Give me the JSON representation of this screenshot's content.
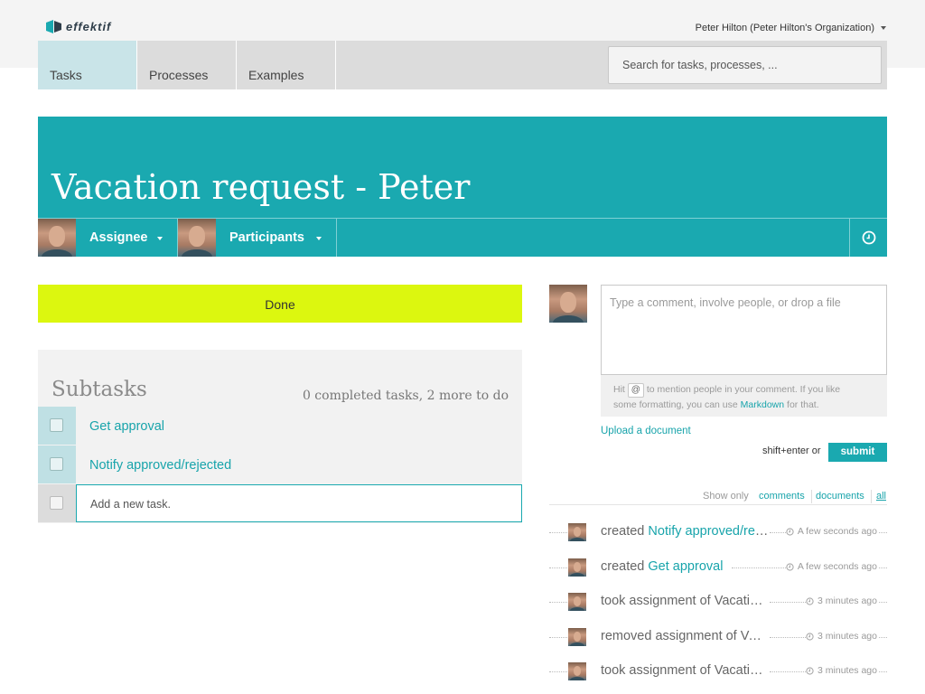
{
  "app": {
    "logo_text": "effektif"
  },
  "header": {
    "user_label": "Peter Hilton (Peter Hilton's Organization)"
  },
  "nav": {
    "tabs": [
      {
        "label": "Tasks",
        "active": true
      },
      {
        "label": "Processes",
        "active": false
      },
      {
        "label": "Examples",
        "active": false
      }
    ],
    "search_text": "Search for tasks, processes, ..."
  },
  "task": {
    "title": "Vacation request - Peter",
    "assignee_label": "Assignee",
    "participants_label": "Participants",
    "done_label": "Done"
  },
  "subtasks": {
    "title": "Subtasks",
    "summary": "0 completed tasks, 2 more to do",
    "items": [
      {
        "label": "Get approval",
        "checked": false
      },
      {
        "label": "Notify approved/rejected",
        "checked": false
      }
    ],
    "new_task_text": "Add a new task."
  },
  "comments": {
    "input_text": "Type a comment, involve people, or drop a file",
    "hint_before_key": "Hit",
    "hint_key": "@",
    "hint_after_key": "to mention people in your comment. If you like",
    "hint_line2_before": "some formatting, you can use",
    "hint_link": "Markdown",
    "hint_line2_after": "for that.",
    "upload_label": "Upload a document",
    "submit_hint": "shift+enter or",
    "submit_label": "submit"
  },
  "activity_filter": {
    "label": "Show only",
    "options": [
      {
        "label": "comments",
        "selected": false
      },
      {
        "label": "documents",
        "selected": false
      },
      {
        "label": "all",
        "selected": true
      }
    ]
  },
  "activity": [
    {
      "action": "created",
      "target": "Notify approved/rejected",
      "time": "A few seconds ago"
    },
    {
      "action": "created",
      "target": "Get approval",
      "time": "A few seconds ago"
    },
    {
      "action": "took assignment of",
      "target": "Vacation request - Peter",
      "time": "3 minutes ago"
    },
    {
      "action": "removed assignment of",
      "target": "Vacation request - Peter",
      "time": "3 minutes ago"
    },
    {
      "action": "took assignment of",
      "target": "Vacation request - Peter",
      "time": "3 minutes ago"
    }
  ],
  "colors": {
    "accent": "#1aa9b0",
    "done": "#dcf70f",
    "tab_active": "#c9e4e8"
  }
}
